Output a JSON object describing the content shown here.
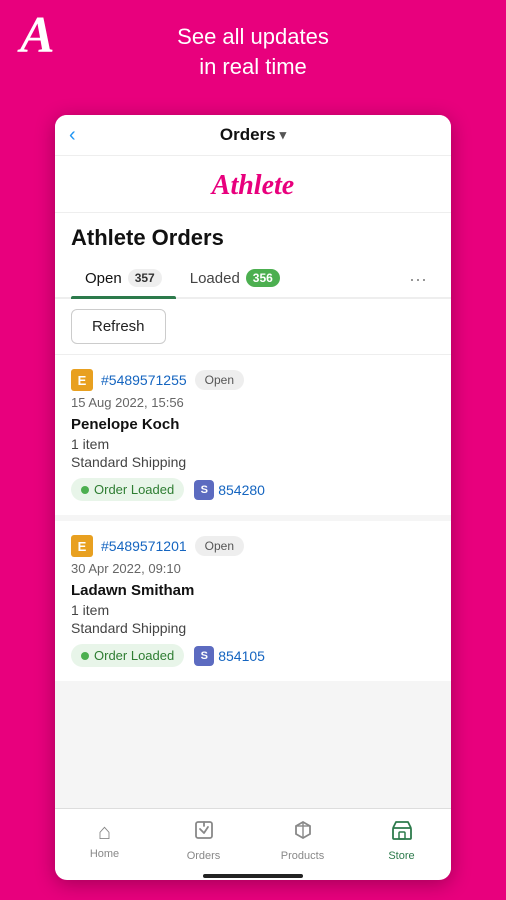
{
  "top": {
    "logo": "A",
    "tagline_line1": "See all updates",
    "tagline_line2": "in real time"
  },
  "nav": {
    "back_icon": "‹",
    "title": "Orders",
    "chevron": "▾"
  },
  "brand": {
    "name": "Athlete"
  },
  "page": {
    "title": "Athlete Orders"
  },
  "tabs": [
    {
      "label": "Open",
      "badge": "357",
      "badge_style": "normal",
      "active": true
    },
    {
      "label": "Loaded",
      "badge": "356",
      "badge_style": "green",
      "active": false
    }
  ],
  "tabs_more": "···",
  "refresh_button": "Refresh",
  "orders": [
    {
      "icon": "E",
      "number": "#5489571255",
      "status": "Open",
      "date": "15 Aug 2022, 15:56",
      "customer": "Penelope Koch",
      "items": "1 item",
      "shipping": "Standard Shipping",
      "loaded_label": "Order Loaded",
      "shopify_label": "S",
      "shopify_ref": "854280"
    },
    {
      "icon": "E",
      "number": "#5489571201",
      "status": "Open",
      "date": "30 Apr 2022, 09:10",
      "customer": "Ladawn Smitham",
      "items": "1 item",
      "shipping": "Standard Shipping",
      "loaded_label": "Order Loaded",
      "shopify_label": "S",
      "shopify_ref": "854105"
    }
  ],
  "bottom_nav": [
    {
      "icon": "⌂",
      "label": "Home",
      "active": false
    },
    {
      "icon": "📥",
      "label": "Orders",
      "active": false
    },
    {
      "icon": "🏷",
      "label": "Products",
      "active": false
    },
    {
      "icon": "🏪",
      "label": "Store",
      "active": true
    }
  ]
}
